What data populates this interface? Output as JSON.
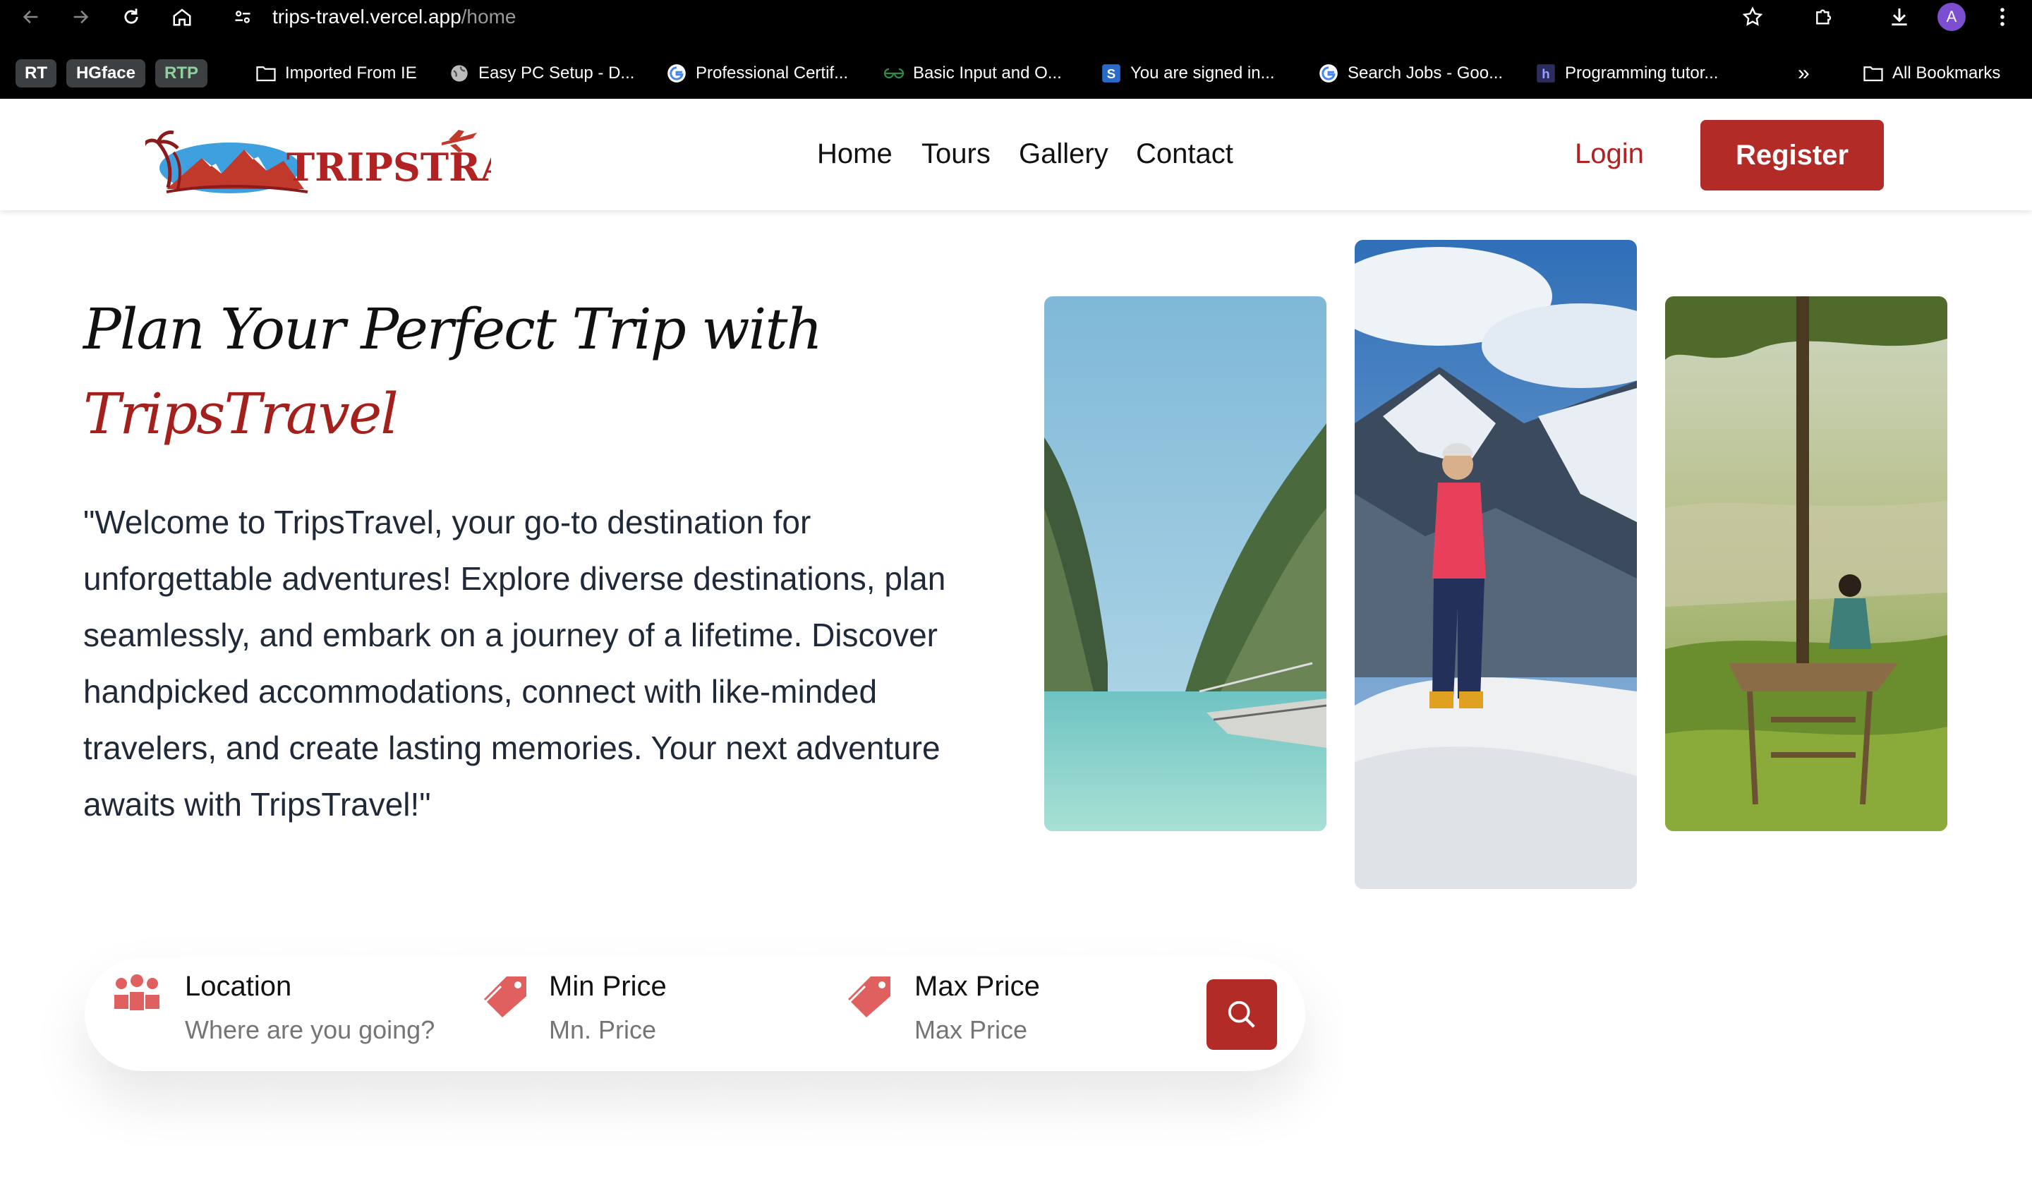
{
  "browser": {
    "url_host": "trips-travel.vercel.app",
    "url_path": "/home",
    "profile_initial": "A",
    "bookmarks": {
      "pills": [
        "RT",
        "HGface",
        "RTP"
      ],
      "items": [
        "Imported From IE",
        "Easy PC Setup - D...",
        "Professional Certif...",
        "Basic Input and O...",
        "You are signed in...",
        "Search Jobs - Goo...",
        "Programming tutor..."
      ],
      "overflow": "»",
      "all_bookmarks": "All Bookmarks"
    }
  },
  "header": {
    "logo_text": "TRIPSTRAVELS",
    "nav": [
      "Home",
      "Tours",
      "Gallery",
      "Contact"
    ],
    "login": "Login",
    "register": "Register"
  },
  "hero": {
    "title_line1": "Plan Your Perfect Trip with",
    "title_line2": "TripsTravel",
    "paragraph_lines": [
      "\"Welcome to TripsTravel, your go-to destination for",
      "unforgettable adventures! Explore diverse destinations, plan",
      "seamlessly, and embark on a journey of a lifetime. Discover",
      "handpicked accommodations, connect with like-minded",
      "travelers, and create lasting memories. Your next adventure",
      "awaits with TripsTravel!\""
    ]
  },
  "search": {
    "location_label": "Location",
    "location_placeholder": "Where are you going?",
    "min_label": "Min Price",
    "min_placeholder": "Mn. Price",
    "max_label": "Max Price",
    "max_placeholder": "Max Price"
  },
  "colors": {
    "brand_red": "#b22b27",
    "icon_red": "#e06060"
  }
}
